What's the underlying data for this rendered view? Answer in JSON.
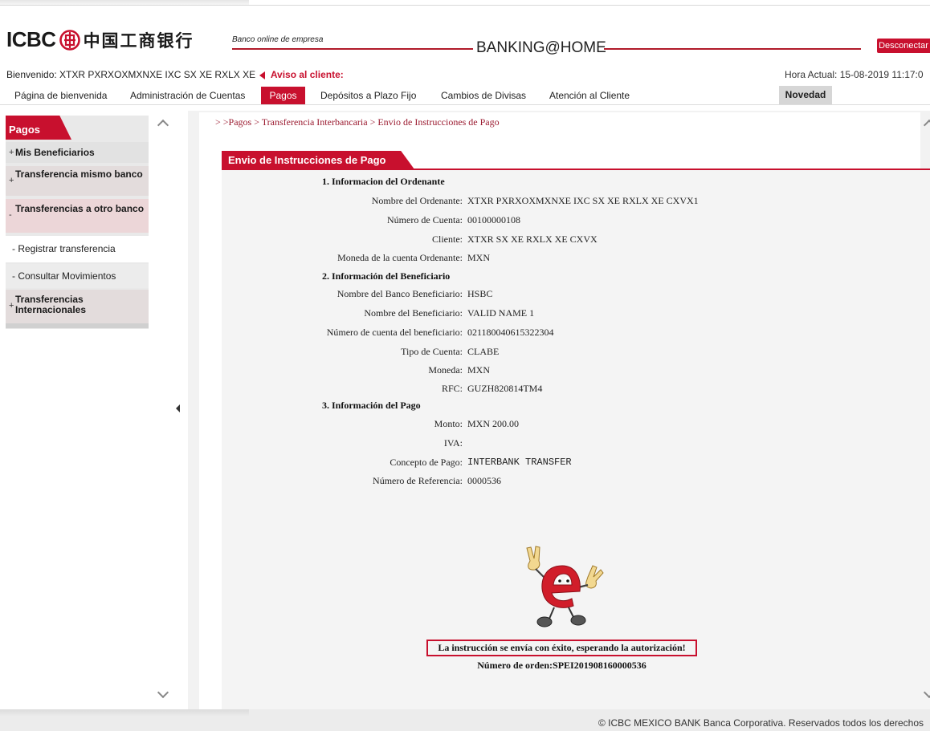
{
  "header": {
    "logo_text": "ICBC",
    "logo_cn": "中国工商银行",
    "banco_online": "Banco online de empresa",
    "banking_home": "BANKING@HOME",
    "disconnect_label": "Desconectar",
    "welcome_text": "Bienvenido: XTXR PXRXOXMXNXE IXC SX XE RXLX XE",
    "aviso_text": "Aviso al cliente:",
    "hora_text": "Hora Actual: 15-08-2019 11:17:0"
  },
  "nav": {
    "items": [
      "Página de bienvenida",
      "Administración de Cuentas",
      "Pagos",
      "Depósitos a Plazo Fijo",
      "Cambios de Divisas",
      "Atención al Cliente"
    ],
    "novedad": "Novedad"
  },
  "sidebar": {
    "title": "Pagos",
    "items": [
      {
        "label": "Mis Beneficiarios",
        "marker": "+"
      },
      {
        "label": "Transferencia mismo banco",
        "marker": "+"
      },
      {
        "label": "Transferencias a otro banco",
        "marker": "-"
      },
      {
        "label": "- Registrar transferencia"
      },
      {
        "label": "- Consultar Movimientos"
      },
      {
        "label": "Transferencias Internacionales",
        "marker": "+"
      }
    ]
  },
  "breadcrumb": "> >Pagos > Transferencia Interbancaria > Envio de Instrucciones de Pago",
  "panel": {
    "title": "Envio de Instrucciones de Pago",
    "sections": {
      "ordenante": "1. Informacion del Ordenante",
      "beneficiario": "2. Información del Beneficiario",
      "pago": "3. Información del Pago"
    },
    "rows": {
      "nombre_ordenante": {
        "label": "Nombre del Ordenante:",
        "value": "XTXR PXRXOXMXNXE IXC SX XE RXLX XE CXVX1"
      },
      "numero_cuenta": {
        "label": "Número de Cuenta:",
        "value": "00100000108"
      },
      "cliente": {
        "label": "Cliente:",
        "value": "XTXR SX XE RXLX XE CXVX"
      },
      "moneda_ordenante": {
        "label": "Moneda de la cuenta Ordenante:",
        "value": "MXN"
      },
      "banco_beneficiario": {
        "label": "Nombre del Banco Beneficiario:",
        "value": "HSBC"
      },
      "nombre_beneficiario": {
        "label": "Nombre del Beneficiario:",
        "value": "VALID NAME 1"
      },
      "cuenta_beneficiario": {
        "label": "Número de cuenta del beneficiario:",
        "value": "021180040615322304"
      },
      "tipo_cuenta": {
        "label": "Tipo de Cuenta:",
        "value": "CLABE"
      },
      "moneda": {
        "label": "Moneda:",
        "value": "MXN"
      },
      "rfc": {
        "label": "RFC:",
        "value": "GUZH820814TM4"
      },
      "monto": {
        "label": "Monto:",
        "value": "MXN 200.00"
      },
      "iva": {
        "label": "IVA:",
        "value": ""
      },
      "concepto": {
        "label": "Concepto de Pago:",
        "value": "INTERBANK TRANSFER"
      },
      "referencia": {
        "label": "Número de Referencia:",
        "value": "0000536"
      }
    },
    "success_message": "La instrucción se envía con éxito, esperando la autorización!",
    "order_number": "Número de orden:SPEI201908160000536"
  },
  "footer": "© ICBC MEXICO BANK Banca Corporativa. Reservados todos los derechos",
  "colors": {
    "brand_red": "#c8102e",
    "breadcrumb_red": "#9b1b30"
  },
  "icons": [
    "icbc-seal-icon",
    "chevron-up-icon",
    "chevron-down-icon",
    "collapse-left-icon",
    "mascot-e-icon"
  ]
}
